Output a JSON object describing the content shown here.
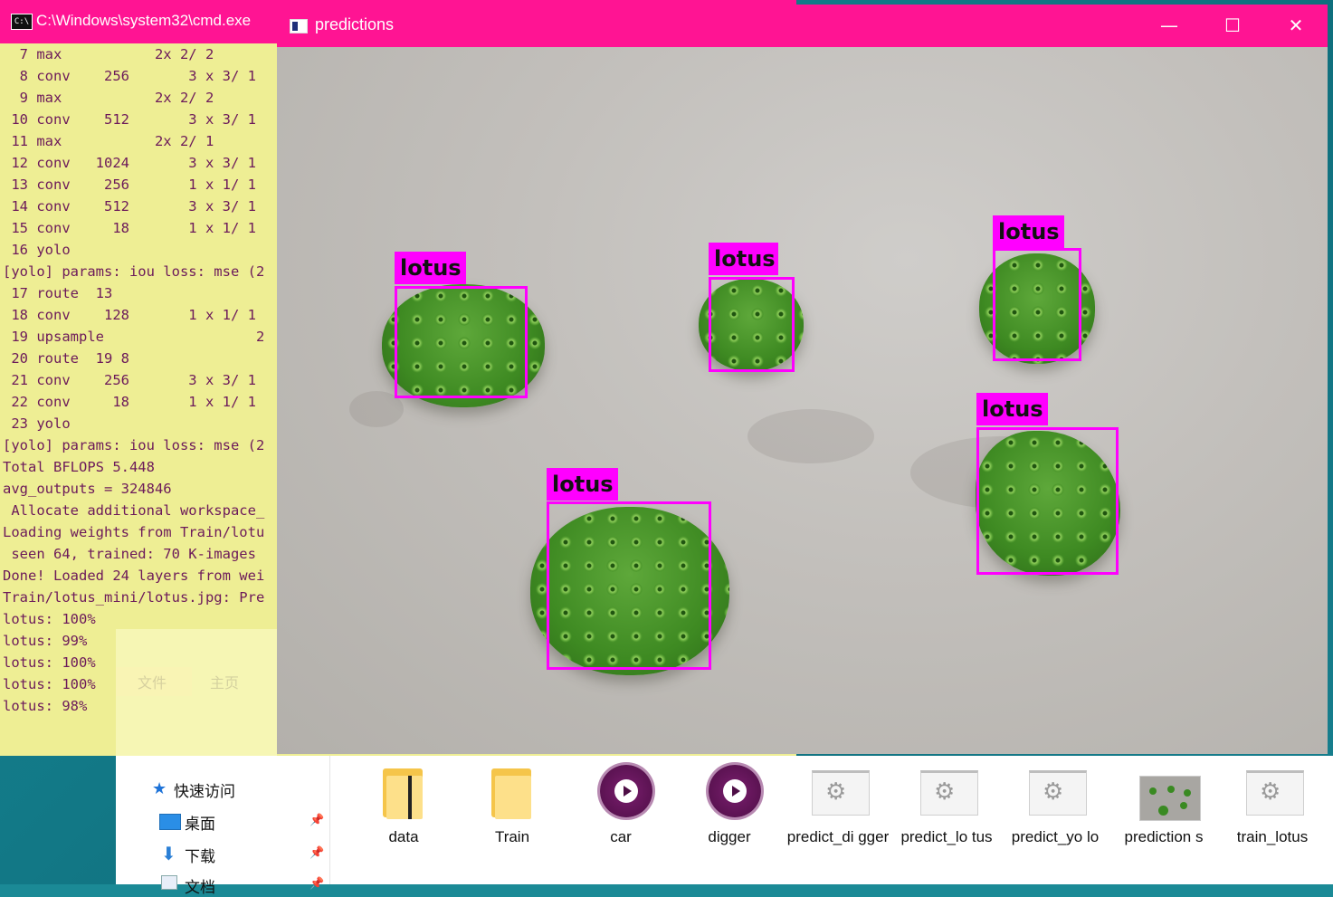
{
  "cmd": {
    "title": "C:\\Windows\\system32\\cmd.exe",
    "lines": [
      "  7 max           2x 2/ 2",
      "  8 conv    256       3 x 3/ 1",
      "  9 max           2x 2/ 2",
      " 10 conv    512       3 x 3/ 1",
      " 11 max           2x 2/ 1",
      " 12 conv   1024       3 x 3/ 1",
      " 13 conv    256       1 x 1/ 1",
      " 14 conv    512       3 x 3/ 1",
      " 15 conv     18       1 x 1/ 1",
      " 16 yolo",
      "[yolo] params: iou loss: mse (2",
      " 17 route  13",
      " 18 conv    128       1 x 1/ 1",
      " 19 upsample                  2",
      " 20 route  19 8",
      " 21 conv    256       3 x 3/ 1",
      " 22 conv     18       1 x 1/ 1",
      " 23 yolo",
      "[yolo] params: iou loss: mse (2",
      "Total BFLOPS 5.448",
      "avg_outputs = 324846",
      " Allocate additional workspace_",
      "Loading weights from Train/lotu",
      " seen 64, trained: 70 K-images",
      "Done! Loaded 24 layers from wei",
      "Train/lotus_mini/lotus.jpg: Pre",
      "lotus: 100%",
      "lotus: 99%",
      "lotus: 100%",
      "lotus: 100%",
      "lotus: 98%"
    ]
  },
  "ghost_ribbon": {
    "tab_file": "文件",
    "tab_home": "主页"
  },
  "predictions": {
    "title": "predictions",
    "buttons": {
      "minimize": "—",
      "maximize": "☐",
      "close": "✕"
    },
    "detections": [
      {
        "label": "lotus"
      },
      {
        "label": "lotus"
      },
      {
        "label": "lotus"
      },
      {
        "label": "lotus"
      },
      {
        "label": "lotus"
      }
    ]
  },
  "explorer": {
    "nav": [
      {
        "label": "快速访问",
        "icon": "star-icon"
      },
      {
        "label": "桌面",
        "icon": "desktop-icon",
        "pinned": true
      },
      {
        "label": "下载",
        "icon": "download-icon",
        "pinned": true
      },
      {
        "label": "文档",
        "icon": "document-icon",
        "pinned": true
      }
    ],
    "files": [
      {
        "name": "data",
        "type": "folder"
      },
      {
        "name": "Train",
        "type": "folder"
      },
      {
        "name": "car",
        "type": "media"
      },
      {
        "name": "digger",
        "type": "media"
      },
      {
        "name": "predict_digger",
        "display": "predict_di gger",
        "type": "script"
      },
      {
        "name": "predict_lotus",
        "display": "predict_lo tus",
        "type": "script"
      },
      {
        "name": "predict_yolo",
        "display": "predict_yo lo",
        "type": "script"
      },
      {
        "name": "predictions",
        "display": "prediction s",
        "type": "image"
      },
      {
        "name": "train_lotus",
        "display": "train_lotus",
        "type": "script"
      }
    ]
  },
  "colors": {
    "titlebar": "#ff1493",
    "cmd_bg": "#eeee94",
    "cmd_text": "#6c1a5a",
    "bbox": "#ff00ff"
  }
}
